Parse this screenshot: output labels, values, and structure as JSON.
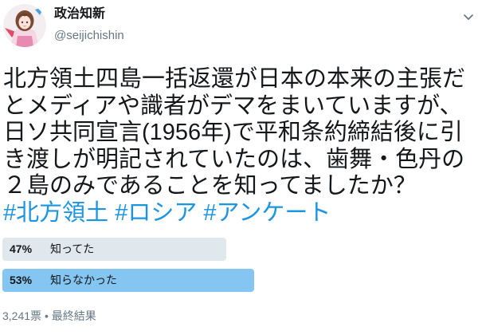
{
  "author": {
    "display_name": "政治知新",
    "handle": "@seijichishin",
    "avatar_icon": "avatar-image"
  },
  "menu_icon": "chevron-down-icon",
  "tweet": {
    "lines": [
      "北方領土四島一括返還が日本の本来の主張だ",
      "とメディアや識者がデマをまいていますが、",
      "日ソ共同宣言(1956年)で平和条約締結後に引",
      "き渡しが明記されていたのは、歯舞・色丹の",
      "２島のみであることを知ってましたか？"
    ],
    "hashtags": [
      "#北方領土",
      "#ロシア",
      "#アンケート"
    ]
  },
  "poll": {
    "options": [
      {
        "percent_label": "47%",
        "label": "知ってた",
        "fraction": 0.47,
        "winner": false
      },
      {
        "percent_label": "53%",
        "label": "知らなかった",
        "fraction": 0.53,
        "winner": true
      }
    ],
    "votes": "3,241票",
    "separator": "•",
    "status": "最終結果"
  },
  "colors": {
    "text": "#14171A",
    "muted": "#657786",
    "link": "#1B95E0",
    "bar": "#E1E8ED",
    "bar_winner": "#84C5F2"
  }
}
